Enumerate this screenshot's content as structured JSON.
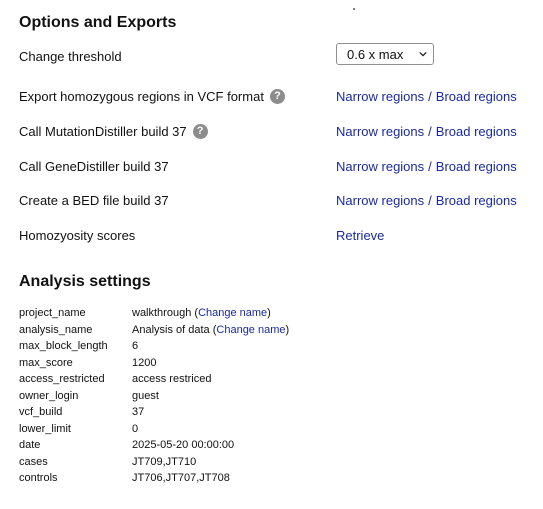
{
  "options": {
    "title": "Options and Exports",
    "threshold": {
      "label": "Change threshold",
      "selected": "0.6 x max"
    },
    "rows": [
      {
        "label": "Export homozygous regions in VCF format",
        "help": true,
        "narrow": "Narrow regions",
        "sep": "/",
        "broad": "Broad regions"
      },
      {
        "label": "Call MutationDistiller build 37",
        "help": true,
        "narrow": "Narrow regions",
        "sep": "/",
        "broad": "Broad regions"
      },
      {
        "label": "Call GeneDistiller build 37",
        "help": false,
        "narrow": "Narrow regions",
        "sep": "/",
        "broad": "Broad regions"
      },
      {
        "label": "Create a BED file build 37",
        "help": false,
        "narrow": "Narrow regions",
        "sep": "/",
        "broad": "Broad regions"
      }
    ],
    "scores": {
      "label": "Homozyosity scores",
      "action": "Retrieve"
    },
    "help_glyph": "?"
  },
  "analysis": {
    "title": "Analysis settings",
    "rows": [
      {
        "key": "project_name",
        "value": "walkthrough",
        "link": "Change name"
      },
      {
        "key": "analysis_name",
        "value": "Analysis of data",
        "link": "Change name"
      },
      {
        "key": "max_block_length",
        "value": "6"
      },
      {
        "key": "max_score",
        "value": "1200"
      },
      {
        "key": "access_restricted",
        "value": "access restriced"
      },
      {
        "key": "owner_login",
        "value": "guest"
      },
      {
        "key": "vcf_build",
        "value": "37"
      },
      {
        "key": "lower_limit",
        "value": "0"
      },
      {
        "key": "date",
        "value": "2025-05-20 00:00:00"
      },
      {
        "key": "cases",
        "value": "JT709,JT710"
      },
      {
        "key": "controls",
        "value": "JT706,JT707,JT708"
      }
    ]
  },
  "colors": {
    "link": "#1a2a9e",
    "help_icon": "#8c8c8c"
  },
  "icons": {
    "help": "question-circle-icon",
    "dropdown": "chevron-down-icon"
  }
}
